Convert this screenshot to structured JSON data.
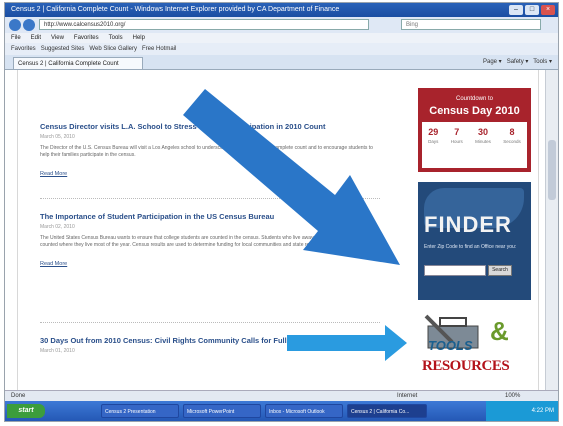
{
  "window": {
    "title": "Census 2 | California Complete Count - Windows Internet Explorer provided by CA Department of Finance"
  },
  "addressbar": {
    "url": "http://www.calcensus2010.org/",
    "search_placeholder": "Bing"
  },
  "menubar": [
    "File",
    "Edit",
    "View",
    "Favorites",
    "Tools",
    "Help"
  ],
  "favorites": {
    "label": "Favorites",
    "items": [
      "Suggested Sites",
      "Web Slice Gallery",
      "Free Hotmail"
    ]
  },
  "tab": {
    "label": "Census 2 | California Complete Count"
  },
  "tabtools": [
    "Page",
    "Safety",
    "Tools"
  ],
  "articles": [
    {
      "title": "Census Director visits L.A. School to Stress Student Participation in 2010 Count",
      "date": "March 05, 2010",
      "body": "The Director of the U.S. Census Bureau will visit a Los Angeles school to underscore the importance of a complete count and to encourage students to help their families participate in the census.",
      "readmore": "Read More"
    },
    {
      "title": "The Importance of Student Participation in the US Census Bureau",
      "date": "March 02, 2010",
      "body": "The United States Census Bureau wants to ensure that college students are counted in the census. Students who live away from home should be counted where they live most of the year. Census results are used to determine funding for local communities and state representation.",
      "readmore": "Read More"
    },
    {
      "title": "30 Days Out from 2010 Census: Civil Rights Community Calls for Full Participation",
      "date": "March 01, 2010"
    }
  ],
  "countdown": {
    "label": "Countdown to",
    "title": "Census Day 2010",
    "units": [
      {
        "value": "29",
        "label": "Days"
      },
      {
        "value": "7",
        "label": "Hours"
      },
      {
        "value": "30",
        "label": "Minutes"
      },
      {
        "value": "8",
        "label": "Seconds"
      }
    ]
  },
  "finder": {
    "title": "FINDER",
    "text": "Enter Zip Code to find an Office near you:",
    "button": "Search"
  },
  "tools": {
    "word1": "TOOLS",
    "amp": "&",
    "word2": "RESOURCES"
  },
  "statusbar": {
    "done": "Done",
    "zone": "Internet",
    "zoom": "100%"
  },
  "taskbar": {
    "start": "start",
    "tasks": [
      "Census 2 Presentation",
      "Microsoft PowerPoint",
      "Inbox - Microsoft Outlook",
      "Census 2 | California Co..."
    ],
    "clock": "4:22 PM"
  },
  "colors": {
    "arrow": "#2a76c8",
    "census_red": "#a8232c",
    "finder_blue": "#234a7a",
    "link_blue": "#2a4f8a"
  }
}
